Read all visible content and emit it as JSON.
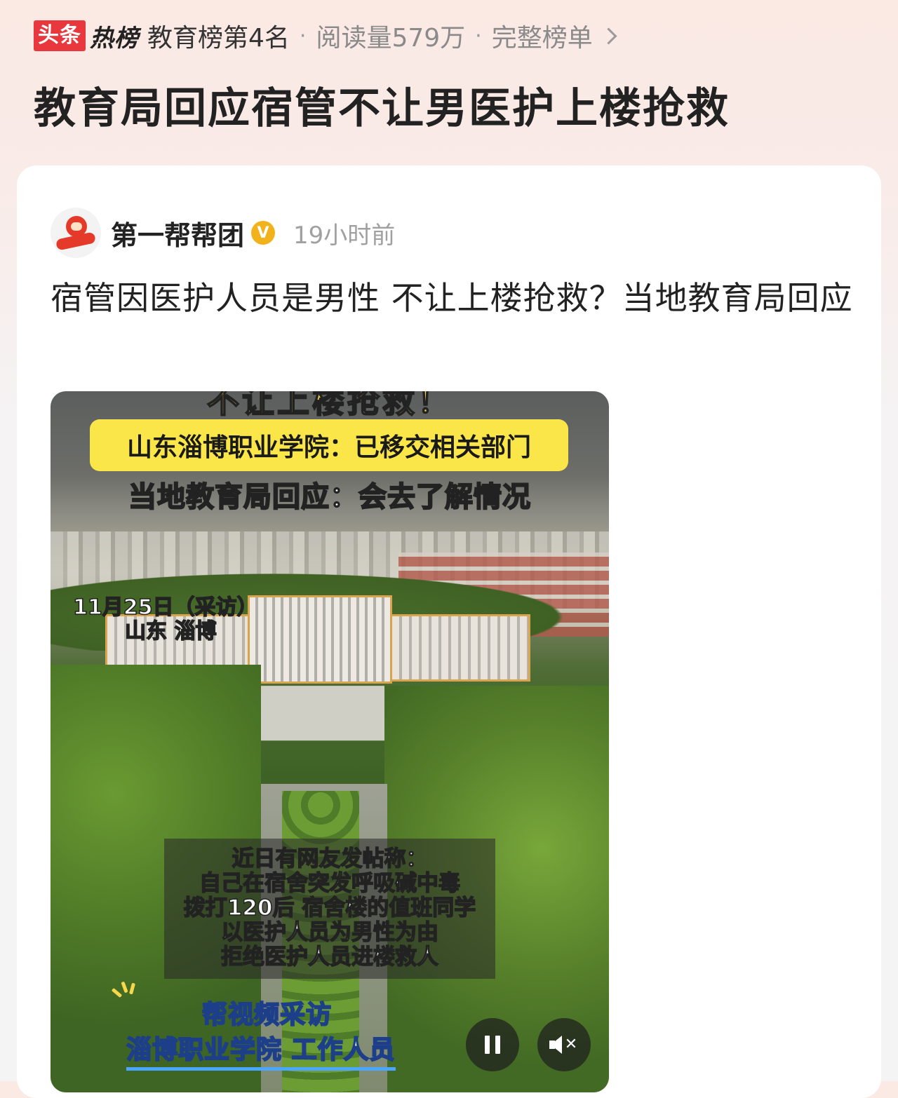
{
  "topbar": {
    "brand_toutiao": "头条",
    "brand_rebang": "热榜",
    "rank_text": "教育榜第4名",
    "separator": "·",
    "reads": "阅读量579万",
    "full_list": "完整榜单"
  },
  "headline": "教育局回应宿管不让男医护上楼抢救",
  "post": {
    "author": "第一帮帮团",
    "verified_mark": "V",
    "time": "19小时前",
    "title": "宿管因医护人员是男性 不让上楼抢救？当地教育局回应"
  },
  "video": {
    "top_clip_text": "不让上楼抢救！",
    "yellow_banner": "山东淄博职业学院：已移交相关部门",
    "white_banner": "当地教育局回应：会去了解情况",
    "date_line1": "11月25日（采访）",
    "date_line2": "山东 淄博",
    "caption_lines": [
      "近日有网友发帖称：",
      "自己在宿舍突发呼吸碱中毒",
      "拨打120后 宿舍楼的值班同学",
      "以医护人员为男性为由",
      "拒绝医护人员进楼救人"
    ],
    "bottom_caption1": "帮视频采访",
    "bottom_caption2": "淄博职业学院 工作人员"
  },
  "icons": {
    "chevron": "chevron-right-icon",
    "pause": "pause-icon",
    "mute": "mute-icon",
    "verified": "verified-badge-icon"
  },
  "colors": {
    "brand_red": "#e8383d",
    "verified_gold": "#f2b21b",
    "banner_yellow": "#fbe64a"
  }
}
